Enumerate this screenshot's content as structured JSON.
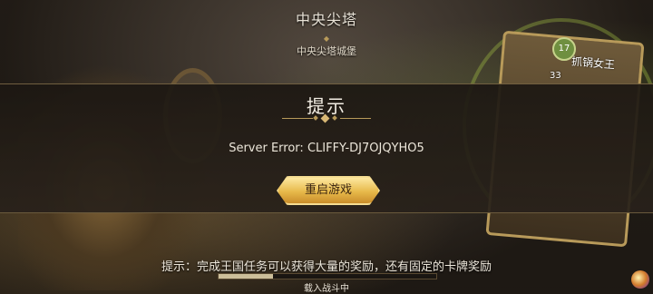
{
  "top": {
    "title": "中央尖塔",
    "subtitle": "中央尖塔城堡"
  },
  "card": {
    "name": "抓锅女王",
    "level": "17",
    "attack": "33"
  },
  "dialog": {
    "title": "提示",
    "message": "Server Error: CLIFFY-DJ7OJQYHO5",
    "button_label": "重启游戏"
  },
  "bottom": {
    "tip_label": "提示：",
    "tip_text": "完成王国任务可以获得大量的奖励，还有固定的卡牌奖励",
    "loading_text": "载入战斗中",
    "loading_progress": 0.25
  }
}
